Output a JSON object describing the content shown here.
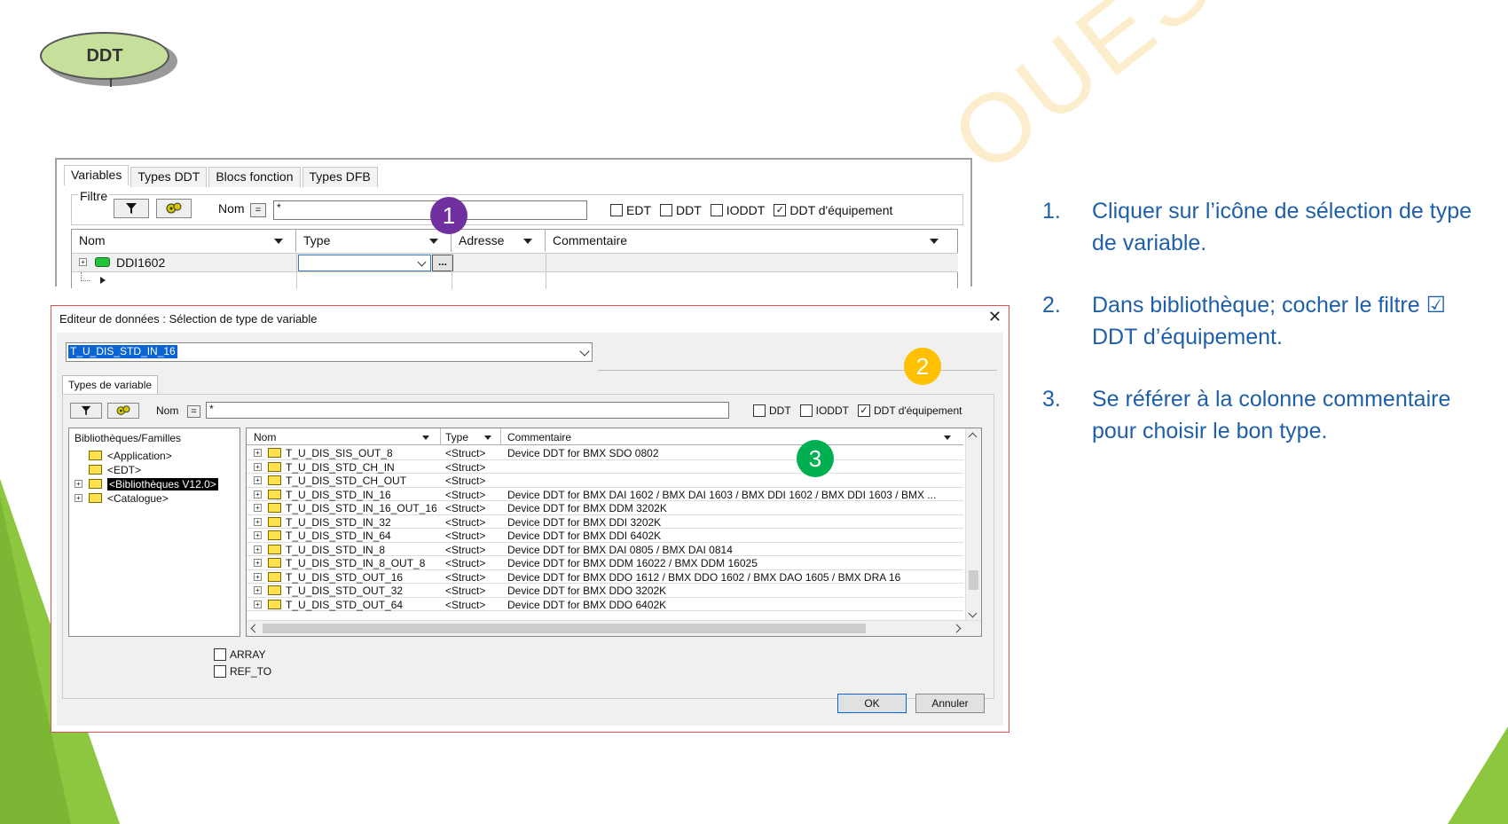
{
  "slide": {
    "badge_label": "DDT",
    "watermark": "OUEST"
  },
  "top_panel": {
    "tabs": [
      "Variables",
      "Types DDT",
      "Blocs fonction",
      "Types DFB"
    ],
    "filter_legend": "Filtre",
    "nom_label": "Nom",
    "eq_label": "=",
    "nom_value": "*",
    "checkboxes": [
      {
        "label": "EDT",
        "checked": false
      },
      {
        "label": "DDT",
        "checked": false
      },
      {
        "label": "IODDT",
        "checked": false
      },
      {
        "label": "DDT d'équipement",
        "checked": true
      }
    ],
    "columns": [
      "Nom",
      "Type",
      "Adresse",
      "Commentaire"
    ],
    "row_name": "DDI1602",
    "ellipsis": "..."
  },
  "badges": [
    "1",
    "2",
    "3"
  ],
  "badge_colors": {
    "one": "#7030a0",
    "two": "#ffc000",
    "three": "#00b050"
  },
  "dialog": {
    "title": "Editeur de données : Sélection de type de variable",
    "close": "✕",
    "combo_value": "T_U_DIS_STD_IN_16",
    "tab_label": "Types de variable",
    "nom_label": "Nom",
    "eq_label": "=",
    "nom_value": "*",
    "checkboxes": [
      {
        "label": "DDT",
        "checked": false
      },
      {
        "label": "IODDT",
        "checked": false
      },
      {
        "label": "DDT d'équipement",
        "checked": true
      }
    ],
    "tree_header": "Bibliothèques/Familles",
    "tree": [
      "<Application>",
      "<EDT>",
      "<Bibliothèques V12.0>",
      "<Catalogue>"
    ],
    "list_columns": [
      "Nom",
      "Type",
      "Commentaire"
    ],
    "rows": [
      {
        "name": "T_U_DIS_SIS_OUT_8",
        "type": "<Struct>",
        "comment": "Device DDT for BMX SDO 0802"
      },
      {
        "name": "T_U_DIS_STD_CH_IN",
        "type": "<Struct>",
        "comment": ""
      },
      {
        "name": "T_U_DIS_STD_CH_OUT",
        "type": "<Struct>",
        "comment": ""
      },
      {
        "name": "T_U_DIS_STD_IN_16",
        "type": "<Struct>",
        "comment": "Device DDT for BMX DAI 1602 / BMX DAI 1603 / BMX DDI 1602 / BMX DDI 1603 / BMX ..."
      },
      {
        "name": "T_U_DIS_STD_IN_16_OUT_16",
        "type": "<Struct>",
        "comment": "Device DDT for BMX DDM 3202K"
      },
      {
        "name": "T_U_DIS_STD_IN_32",
        "type": "<Struct>",
        "comment": "Device DDT for BMX DDI 3202K"
      },
      {
        "name": "T_U_DIS_STD_IN_64",
        "type": "<Struct>",
        "comment": "Device DDT for BMX DDI 6402K"
      },
      {
        "name": "T_U_DIS_STD_IN_8",
        "type": "<Struct>",
        "comment": "Device DDT for BMX DAI 0805 / BMX DAI 0814"
      },
      {
        "name": "T_U_DIS_STD_IN_8_OUT_8",
        "type": "<Struct>",
        "comment": "Device DDT for BMX DDM 16022 / BMX DDM 16025"
      },
      {
        "name": "T_U_DIS_STD_OUT_16",
        "type": "<Struct>",
        "comment": "Device DDT for BMX DDO 1612 / BMX DDO 1602 / BMX DAO 1605 / BMX DRA 16"
      },
      {
        "name": "T_U_DIS_STD_OUT_32",
        "type": "<Struct>",
        "comment": "Device DDT for BMX DDO 3202K"
      },
      {
        "name": "T_U_DIS_STD_OUT_64",
        "type": "<Struct>",
        "comment": "Device DDT for BMX DDO 6402K"
      }
    ],
    "array_label": "ARRAY",
    "ref_to_label": "REF_TO",
    "ok_label": "OK",
    "cancel_label": "Annuler"
  },
  "steps": [
    {
      "num": "1.",
      "text": "Cliquer sur l’icône de sélection de type de variable."
    },
    {
      "num": "2.",
      "text": "Dans bibliothèque; cocher le filtre ☑ DDT d’équipement."
    },
    {
      "num": "3.",
      "text": "Se référer à la colonne commentaire pour choisir le bon type."
    }
  ]
}
